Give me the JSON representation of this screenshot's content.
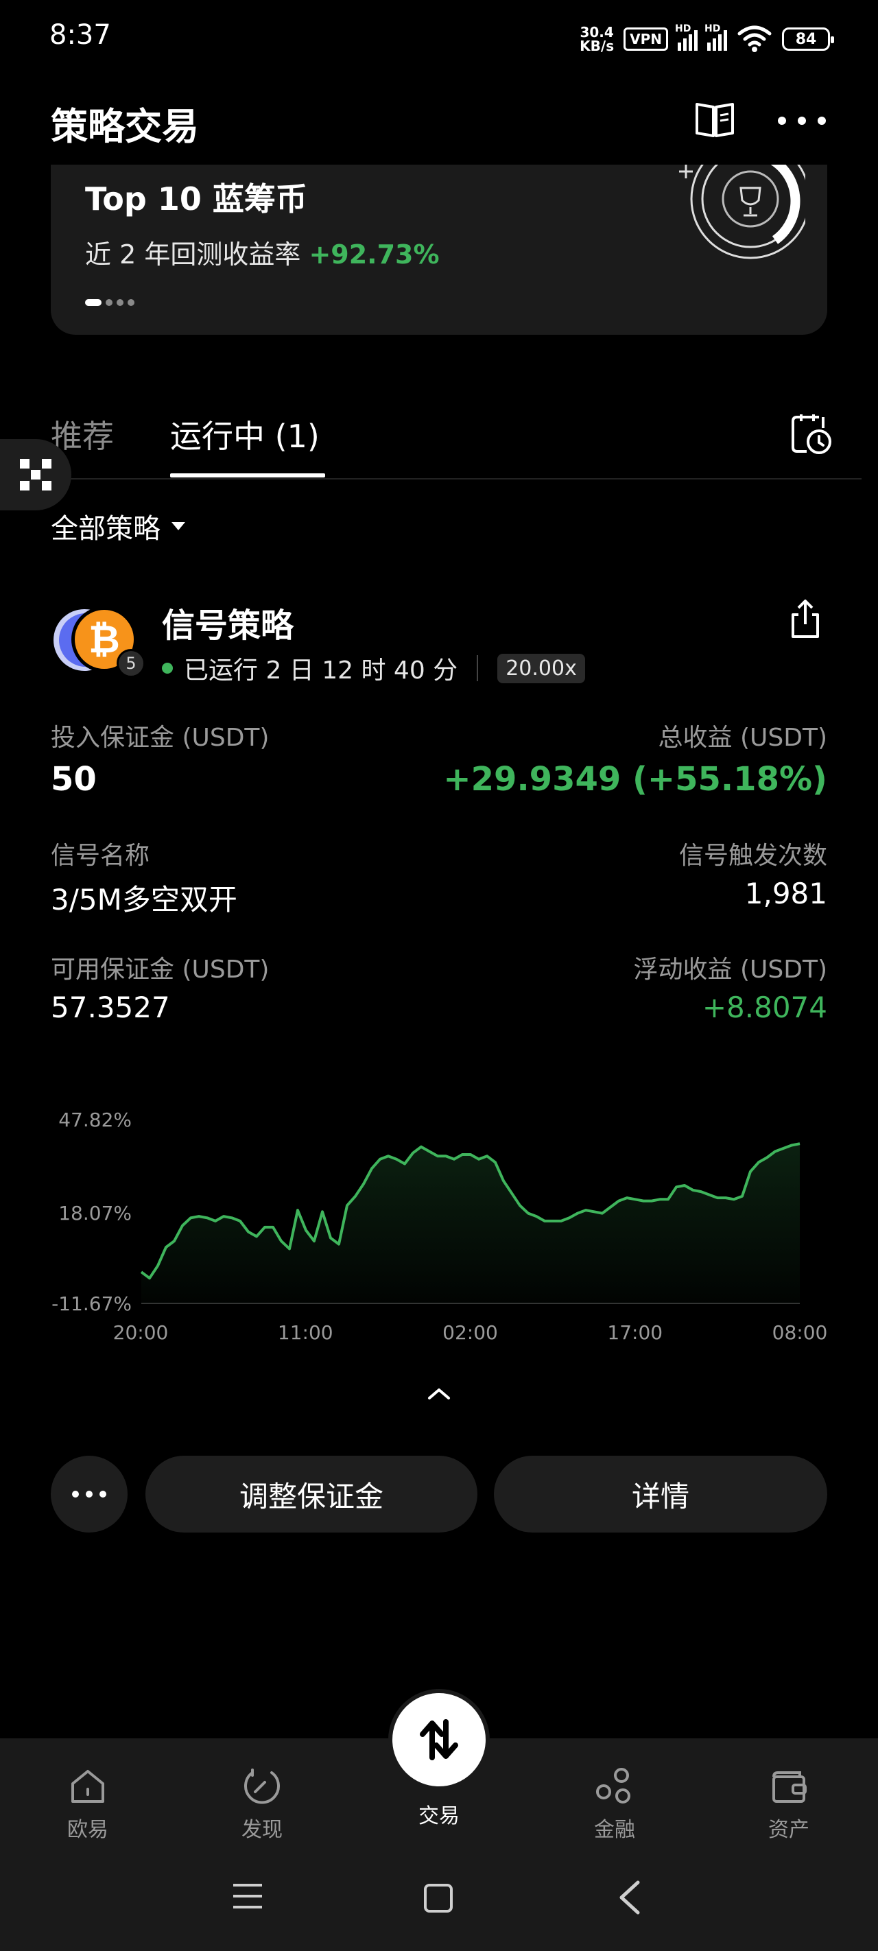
{
  "status_bar": {
    "time": "8:37",
    "net_speed_value": "30.4",
    "net_speed_unit": "KB/s",
    "vpn": "VPN",
    "signal_1_label": "HD",
    "signal_2_label": "HD",
    "battery": "84"
  },
  "header": {
    "title": "策略交易"
  },
  "promo": {
    "title": "Top 10 蓝筹币",
    "subtitle_prefix": "近 2 年回测收益率",
    "subtitle_value": "+92.73%",
    "pages": 4,
    "active_page": 1
  },
  "tabs": [
    {
      "label": "推荐",
      "active": false
    },
    {
      "label": "运行中 (1)",
      "active": true
    }
  ],
  "filter": {
    "label": "全部策略"
  },
  "strategy": {
    "name": "信号策略",
    "coin_symbol": "₿",
    "coin_count": "5",
    "running_time": "已运行 2 日 12 时 40 分",
    "leverage": "20.00x",
    "margin_label": "投入保证金 (USDT)",
    "margin_value": "50",
    "total_profit_label": "总收益 (USDT)",
    "total_profit_value": "+29.9349 (+55.18%)",
    "signal_name_label": "信号名称",
    "signal_name_value": "3/5M多空双开",
    "signal_count_label": "信号触发次数",
    "signal_count_value": "1,981",
    "available_margin_label": "可用保证金 (USDT)",
    "available_margin_value": "57.3527",
    "floating_profit_label": "浮动收益 (USDT)",
    "floating_profit_value": "+8.8074"
  },
  "chart_data": {
    "type": "area",
    "y_tick_labels": [
      "47.82%",
      "18.07%",
      "-11.67%"
    ],
    "ylim": [
      -11.67,
      47.82
    ],
    "x_tick_labels": [
      "20:00",
      "11:00",
      "02:00",
      "17:00",
      "08:00"
    ],
    "x": [
      0,
      1,
      2,
      3,
      4,
      5,
      6,
      7,
      8,
      9,
      10,
      11,
      12,
      13,
      14,
      15,
      16,
      17,
      18,
      19,
      20,
      21,
      22,
      23,
      24,
      25,
      26,
      27,
      28,
      29,
      30,
      31,
      32,
      33,
      34,
      35,
      36,
      37,
      38,
      39,
      40,
      41,
      42,
      43,
      44,
      45,
      46,
      47,
      48,
      49,
      50,
      51,
      52,
      53,
      54,
      55,
      56,
      57,
      58,
      59,
      60,
      61,
      62,
      63,
      64,
      65,
      66,
      67,
      68,
      69,
      70,
      71,
      72,
      73,
      74,
      75,
      76,
      77,
      78,
      79,
      80
    ],
    "series": [
      {
        "values": [
          -1.5,
          -3.5,
          0.5,
          6.5,
          8.5,
          13.5,
          16.0,
          16.5,
          16.0,
          15.0,
          16.5,
          16.0,
          15.0,
          11.5,
          10.0,
          13.0,
          13.0,
          8.5,
          6.0,
          18.5,
          12.0,
          8.5,
          18.0,
          9.5,
          7.5,
          20.0,
          23.0,
          27.0,
          32.0,
          35.0,
          36.0,
          35.0,
          33.5,
          37.0,
          39.0,
          37.5,
          36.0,
          36.0,
          35.0,
          36.5,
          36.5,
          35.0,
          36.0,
          34.0,
          28.0,
          24.0,
          20.0,
          17.5,
          16.5,
          15.0,
          15.0,
          15.0,
          16.0,
          17.5,
          18.5,
          18.0,
          17.5,
          19.5,
          21.5,
          22.5,
          22.0,
          21.5,
          21.5,
          22.0,
          22.0,
          26.0,
          26.5,
          25.0,
          24.5,
          23.5,
          22.5,
          22.5,
          22.0,
          23.0,
          31.0,
          34.0,
          35.5,
          37.5,
          38.5,
          39.5,
          40.0
        ]
      }
    ],
    "line_color": "#3fb55c",
    "grid": false
  },
  "actions": {
    "adjust_margin": "调整保证金",
    "details": "详情"
  },
  "bottom_nav": [
    {
      "label": "欧易",
      "icon": "home-icon"
    },
    {
      "label": "发现",
      "icon": "compass-icon"
    },
    {
      "label": "交易",
      "icon": "trade-icon",
      "active": true
    },
    {
      "label": "金融",
      "icon": "finance-icon"
    },
    {
      "label": "资产",
      "icon": "wallet-icon"
    }
  ],
  "colors": {
    "background": "#000000",
    "card": "#1b1b1b",
    "positive": "#3fb55c",
    "muted_text": "#9a9a9a"
  }
}
